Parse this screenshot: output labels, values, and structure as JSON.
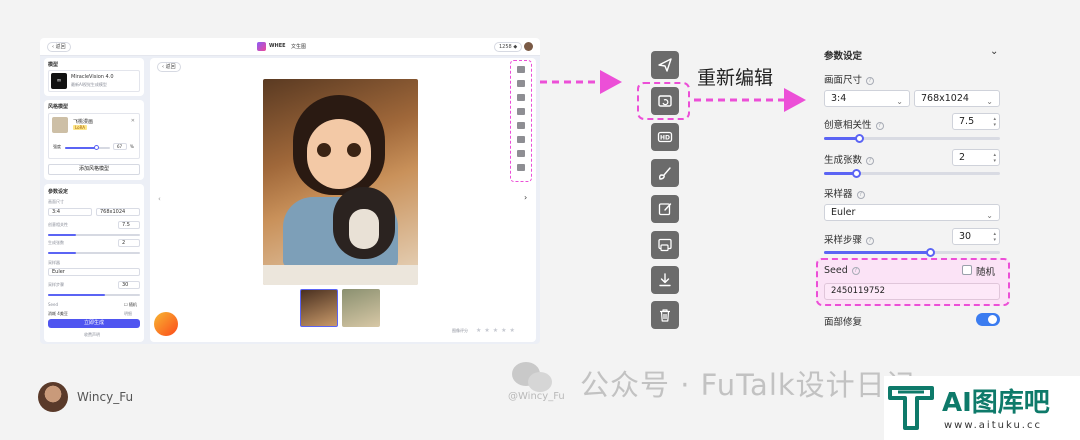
{
  "colors": {
    "accent": "#5b64f4",
    "annotation": "#ec4fd7",
    "tool_bg": "#6b6b6b",
    "toggle_on": "#3b7cf0"
  },
  "app": {
    "back_label": "返回",
    "brand": "WHEE",
    "page_title": "文生图",
    "credits": "1258",
    "model": {
      "section": "模型",
      "name": "MiracleVision 4.0",
      "desc": "最新AI视觉生成模型"
    },
    "style": {
      "section": "风格模型",
      "name": "飞桃漫画",
      "tag": "LoRA",
      "strength_label": "强度",
      "strength_value": "67",
      "pct": "%",
      "add_button": "添加风格模型"
    },
    "params": {
      "section": "参数设定",
      "size_label": "画面尺寸",
      "ratio": "3:4",
      "dims": "768x1024",
      "creativity_label": "创意相关性",
      "creativity_value": "7.5",
      "count_label": "生成张数",
      "count_value": "2",
      "sampler_label": "采样器",
      "sampler_value": "Euler",
      "steps_label": "采样步骤",
      "steps_value": "30",
      "seed_label": "Seed",
      "random_label": "随机",
      "cost_label": "消耗 4美豆",
      "detail_label": "明细",
      "generate_button": "立即生成",
      "rules_label": "收费声明"
    },
    "canvas": {
      "back_label": "返回",
      "rating_label": "图像评分"
    }
  },
  "toolbar": {
    "redit_label": "重新编辑",
    "icons": [
      "send-icon",
      "reedit-icon",
      "hd-icon",
      "brush-icon",
      "edit-icon",
      "image-swap-icon",
      "download-icon",
      "trash-icon"
    ]
  },
  "panel": {
    "title": "参数设定",
    "size_label": "画面尺寸",
    "ratio": "3:4",
    "dims": "768x1024",
    "creativity_label": "创意相关性",
    "creativity_value": "7.5",
    "creativity_level": 0.2,
    "count_label": "生成张数",
    "count_value": "2",
    "count_level": 0.18,
    "sampler_label": "采样器",
    "sampler_value": "Euler",
    "steps_label": "采样步骤",
    "steps_value": "30",
    "steps_level": 0.6,
    "seed_label": "Seed",
    "random_label": "随机",
    "seed_value": "2450119752",
    "face_label": "面部修复",
    "face_on": true
  },
  "footer": {
    "author": "Wincy_Fu",
    "watermark_handle": "@Wincy_Fu",
    "watermark": "公众号 · FuTalk设计日记",
    "site_name": "AI图库吧",
    "site_url": "www.aituku.cc"
  }
}
